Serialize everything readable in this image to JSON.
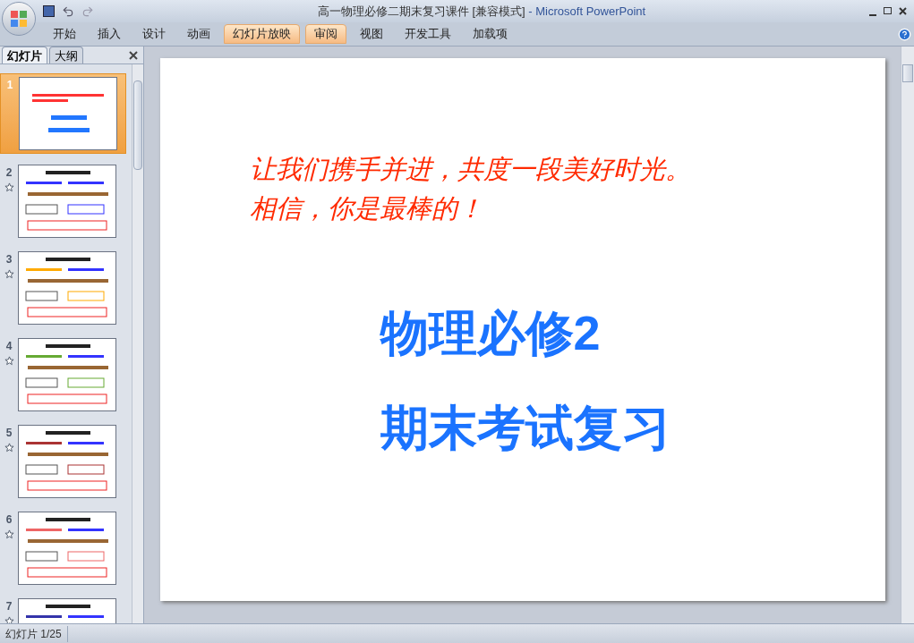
{
  "window": {
    "title": "高一物理必修二期末复习课件 [兼容模式]",
    "app_name": " - Microsoft PowerPoint"
  },
  "ribbon_tabs": [
    {
      "label": "开始",
      "highlighted": false
    },
    {
      "label": "插入",
      "highlighted": false
    },
    {
      "label": "设计",
      "highlighted": false
    },
    {
      "label": "动画",
      "highlighted": false
    },
    {
      "label": "幻灯片放映",
      "highlighted": true
    },
    {
      "label": "审阅",
      "highlighted": true
    },
    {
      "label": "视图",
      "highlighted": false
    },
    {
      "label": "开发工具",
      "highlighted": false
    },
    {
      "label": "加载项",
      "highlighted": false
    }
  ],
  "panel_tabs": [
    {
      "label": "幻灯片",
      "selected": true
    },
    {
      "label": "大纲",
      "selected": false
    }
  ],
  "slides": [
    {
      "number": "1",
      "selected": true,
      "animated": false
    },
    {
      "number": "2",
      "selected": false,
      "animated": true
    },
    {
      "number": "3",
      "selected": false,
      "animated": true
    },
    {
      "number": "4",
      "selected": false,
      "animated": true
    },
    {
      "number": "5",
      "selected": false,
      "animated": true
    },
    {
      "number": "6",
      "selected": false,
      "animated": true
    },
    {
      "number": "7",
      "selected": false,
      "animated": true
    }
  ],
  "slide": {
    "intro_lines": [
      "让我们携手并进，共度一段美好时光。",
      "相信，你是最棒的！"
    ],
    "title_lines": [
      "物理必修2",
      "期末考试复习"
    ]
  },
  "status_bar": {
    "slide_counter": "幻灯片 1/25"
  }
}
